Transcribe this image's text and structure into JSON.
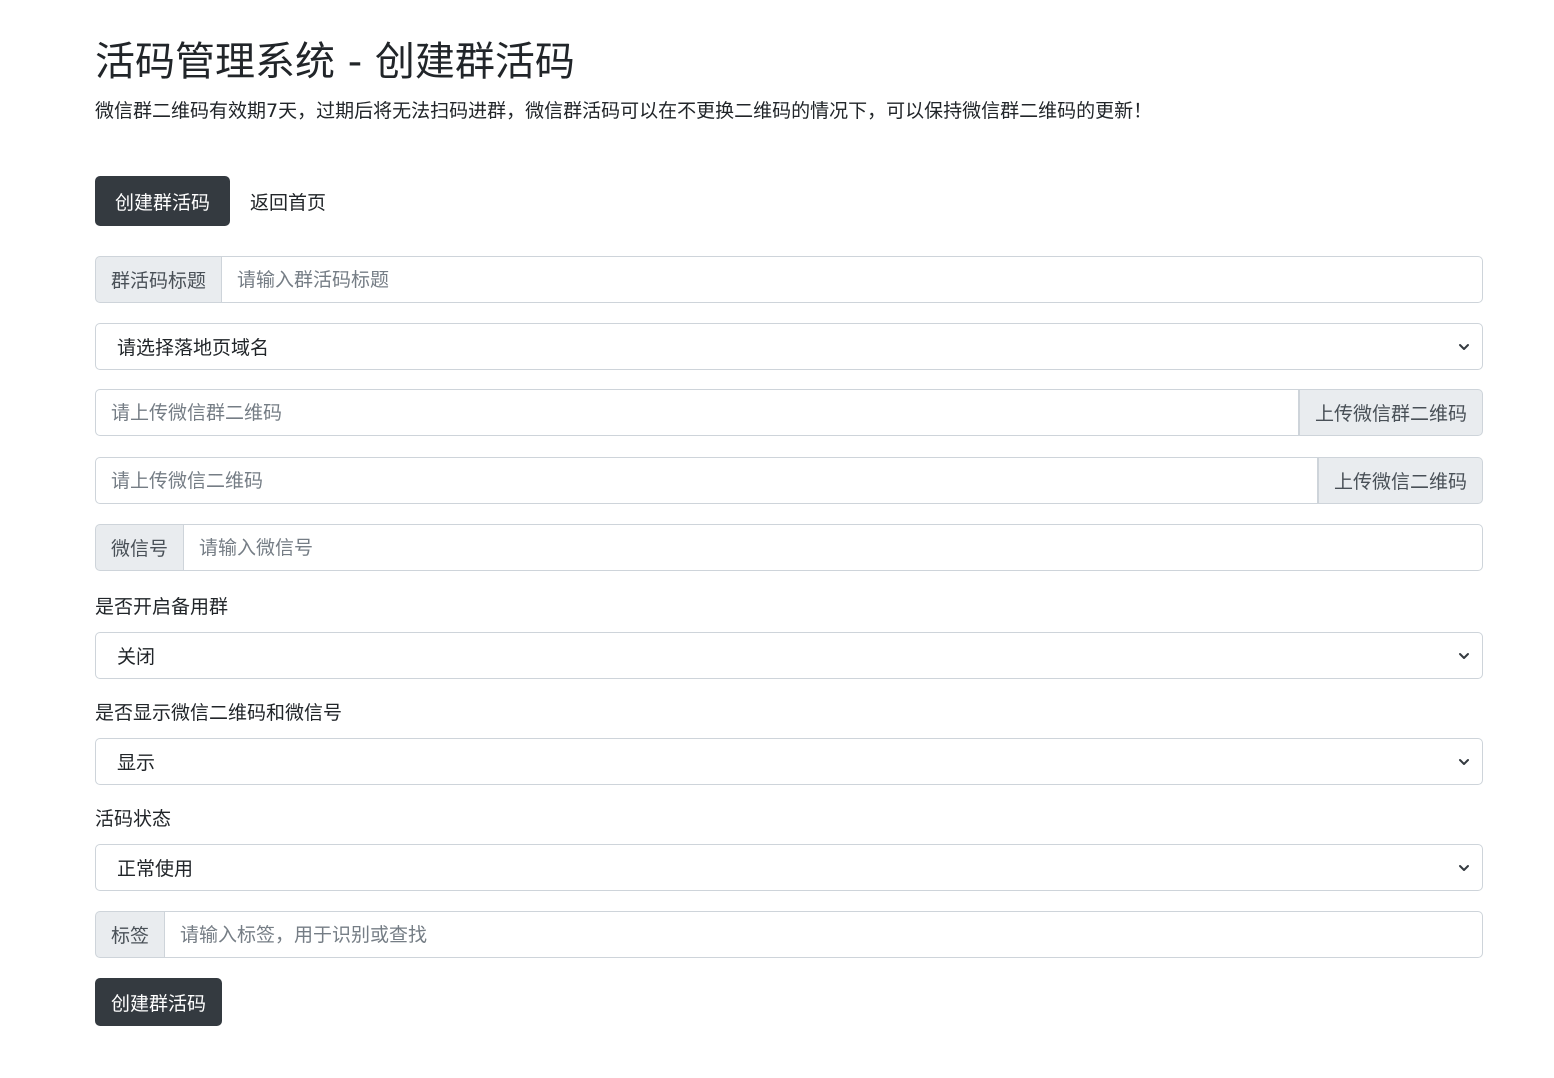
{
  "header": {
    "title": "活码管理系统 - 创建群活码",
    "description": "微信群二维码有效期7天，过期后将无法扫码进群，微信群活码可以在不更换二维码的情况下，可以保持微信群二维码的更新！"
  },
  "nav": {
    "active_tab": "创建群活码",
    "home_link": "返回首页"
  },
  "form": {
    "title_field": {
      "addon": "群活码标题",
      "placeholder": "请输入群活码标题"
    },
    "domain_select": {
      "selected": "请选择落地页域名"
    },
    "group_qr_field": {
      "placeholder": "请上传微信群二维码",
      "button": "上传微信群二维码"
    },
    "wechat_qr_field": {
      "placeholder": "请上传微信二维码",
      "button": "上传微信二维码"
    },
    "wechat_id_field": {
      "addon": "微信号",
      "placeholder": "请输入微信号"
    },
    "backup_group": {
      "label": "是否开启备用群",
      "selected": "关闭"
    },
    "show_wechat": {
      "label": "是否显示微信二维码和微信号",
      "selected": "显示"
    },
    "status": {
      "label": "活码状态",
      "selected": "正常使用"
    },
    "tag_field": {
      "addon": "标签",
      "placeholder": "请输入标签，用于识别或查找"
    },
    "submit_label": "创建群活码"
  }
}
